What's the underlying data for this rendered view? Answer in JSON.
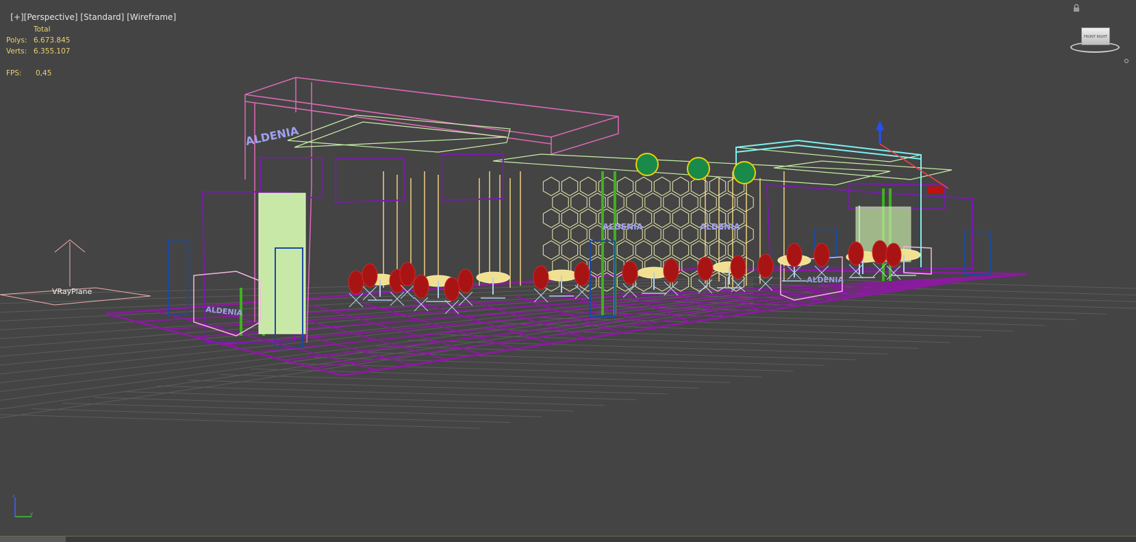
{
  "viewport": {
    "plus_label": "[+]",
    "view_label": "[Perspective]",
    "shading_label": "[Standard]",
    "mode_label": "[Wireframe]"
  },
  "stats": {
    "header": "Total",
    "polys_label": "Polys:",
    "polys_value": "6.673.845",
    "verts_label": "Verts:",
    "verts_value": "6.355.107",
    "fps_label": "FPS:",
    "fps_value": "0,45"
  },
  "scene": {
    "object_label": "VRayPlane",
    "sign_text": "ALDENIA"
  },
  "viewcube": {
    "face_text": "FRONT  RIGHT"
  },
  "colors": {
    "background": "#444444",
    "grid": "#5c5c5c",
    "stats_text": "#e8d272",
    "floor": "#8a1a9e",
    "canopy_pink": "#e06ab8",
    "frame_yellow": "#f0e080",
    "frame_green": "#b8f0a0",
    "frame_purple": "#7a1ab0",
    "chairs": "#b01818",
    "cyan": "#7ff0f0",
    "blue": "#1a4aa0"
  }
}
